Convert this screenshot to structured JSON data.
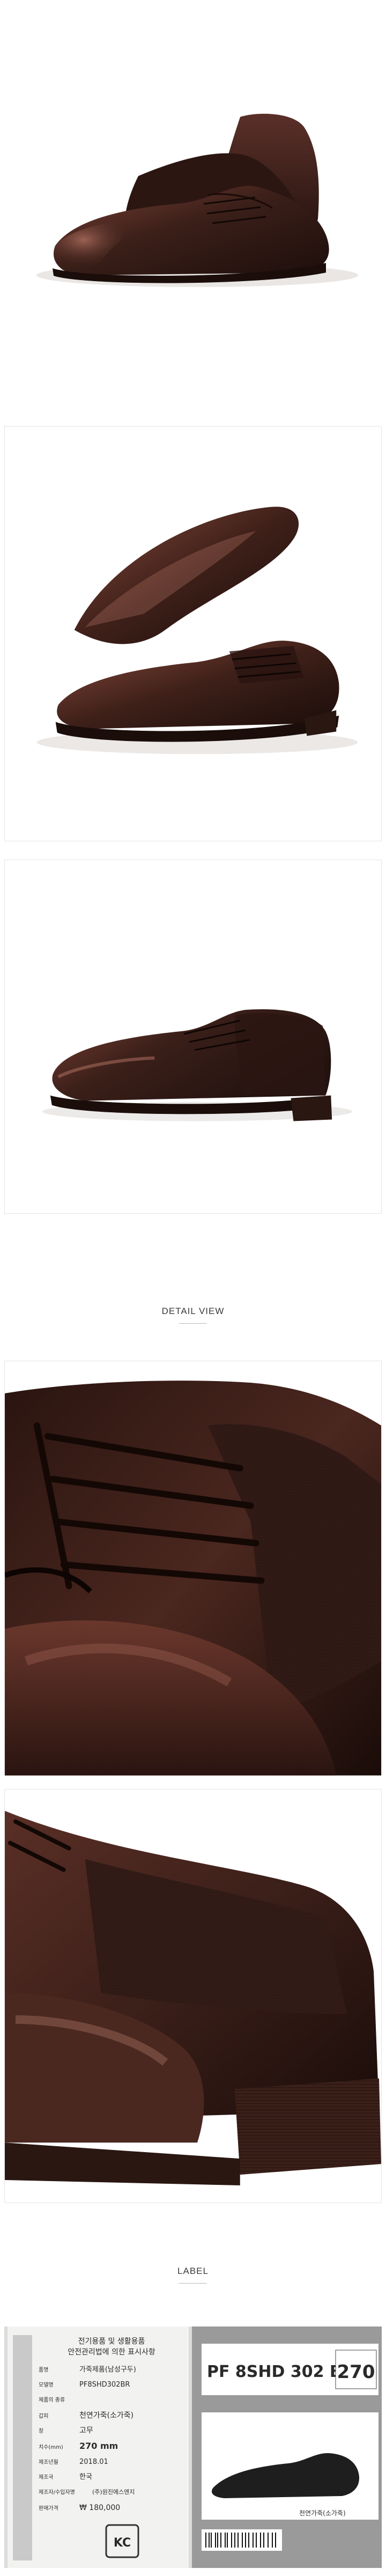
{
  "colors": {
    "leather": "#3b1f19",
    "leather_highlight": "#6e3b30",
    "leather_dark": "#1f0f0c",
    "sole": "#2a1712",
    "background": "#ffffff",
    "label_bg": "#ececec",
    "label_gray_panel": "#9a9a9a"
  },
  "sections": {
    "detail_heading": "DETAIL VIEW",
    "label_heading": "LABEL"
  },
  "label_tag": {
    "header_line1": "전기용품 및 생활용품",
    "header_line2": "안전관리법에 의한 표시사항",
    "rows": [
      {
        "key": "품명",
        "value": "가죽제품(남성구두)"
      },
      {
        "key": "모델명",
        "value": "PF8SHD302BR"
      },
      {
        "key": "제품의 종류",
        "value": ""
      },
      {
        "key": "갑피",
        "value": "천연가죽(소가죽)"
      },
      {
        "key": "창",
        "value": "고무"
      },
      {
        "key": "치수(mm)",
        "value": "270 mm"
      },
      {
        "key": "제조년월",
        "value": "2018.01"
      },
      {
        "key": "제조국",
        "value": "한국"
      },
      {
        "key": "제조자/수입자명",
        "value": "(주)원진에스엔지"
      },
      {
        "key": "판매가격",
        "value": "₩ 180,000"
      }
    ],
    "cert_mark": "KC",
    "box_code": "PF 8SHD 302 BR",
    "box_size": "270",
    "box_material": "천연가죽(소가죽)"
  },
  "icons": {
    "shoe_photo_1": "oxford-shoe-pair-photo",
    "shoe_photo_2": "oxford-shoe-pair-angled-photo",
    "shoe_photo_3": "oxford-shoe-side-photo",
    "detail_photo_1": "lacing-closeup-photo",
    "detail_photo_2": "heel-closeup-photo",
    "label_photo": "product-label-photo",
    "cert_icon": "kc-certification-icon"
  }
}
